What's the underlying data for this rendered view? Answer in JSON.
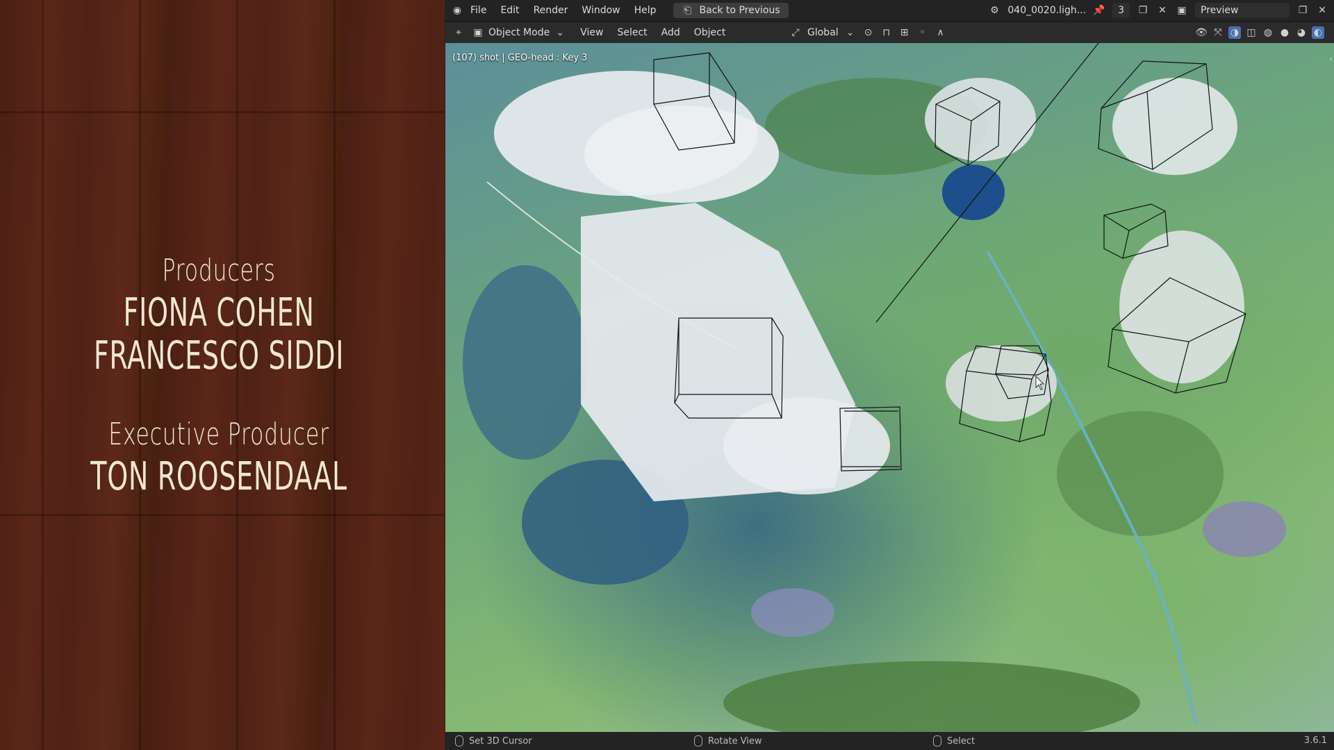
{
  "credits": {
    "producers_role": "Producers",
    "producer_1": "FIONA COHEN",
    "producer_2": "FRANCESCO SIDDI",
    "exec_role": "Executive Producer",
    "exec_name": "TON ROOSENDAAL"
  },
  "topbar": {
    "menu": [
      "File",
      "Edit",
      "Render",
      "Window",
      "Help"
    ],
    "back_button": "Back to Previous",
    "scene_name": "040_0020.ligh...",
    "layer_count": "3",
    "view_layer": "Preview"
  },
  "header": {
    "mode": "Object Mode",
    "menu": [
      "View",
      "Select",
      "Add",
      "Object"
    ],
    "transform_orientation": "Global"
  },
  "viewport": {
    "info_text": "(107) shot | GEO-head : Key 3"
  },
  "status": {
    "left_click": "Set 3D Cursor",
    "middle_click": "Rotate View",
    "right_click": "Select",
    "version": "3.6.1"
  },
  "colors": {
    "accent": "#4772b3",
    "topbar": "#232323",
    "header": "#2b2b2b"
  }
}
